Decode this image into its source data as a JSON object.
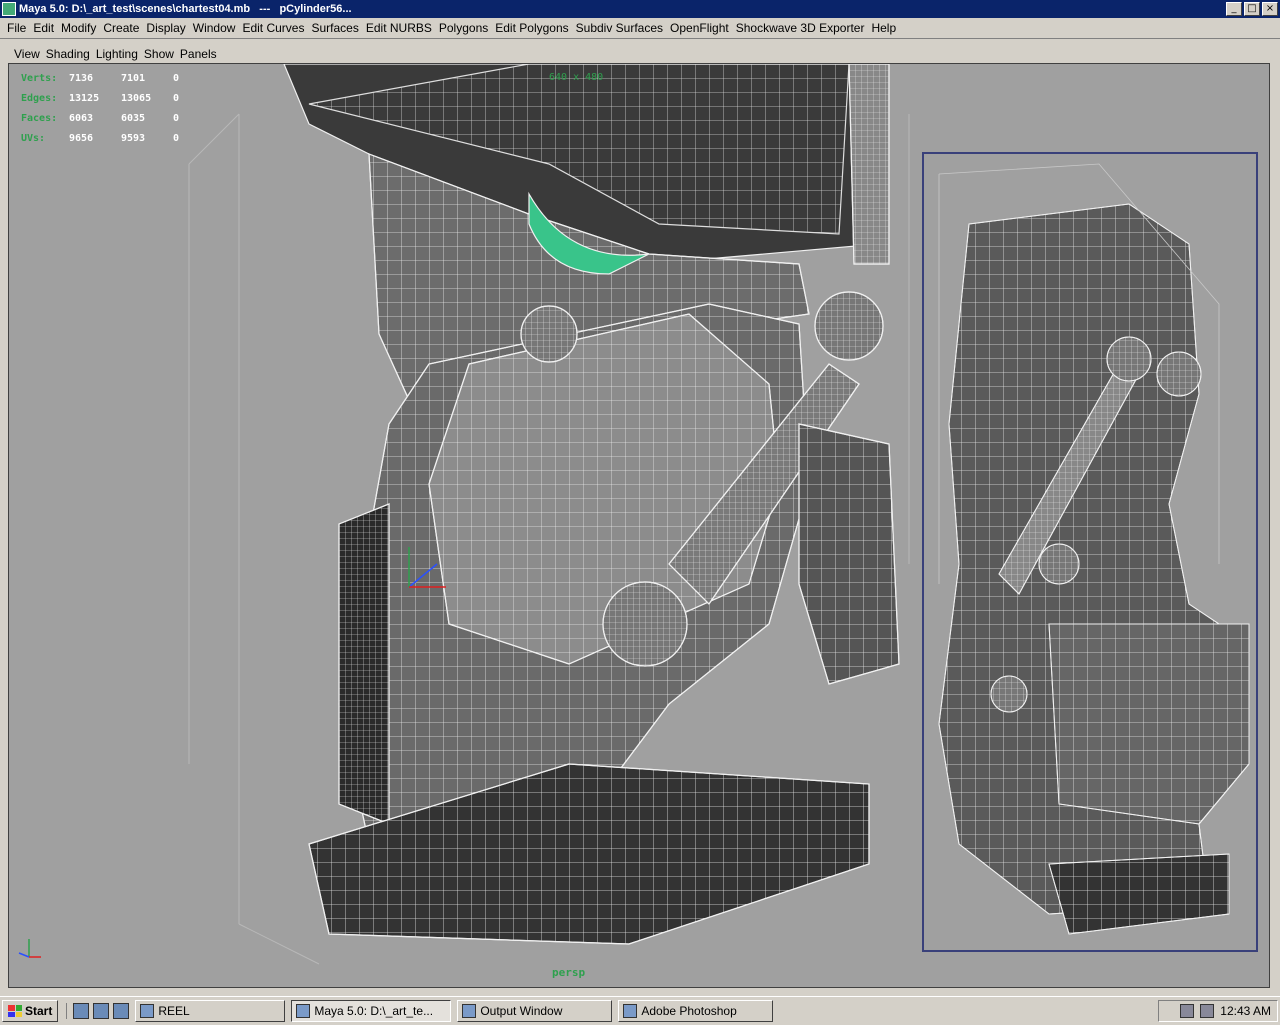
{
  "window": {
    "title": "Maya 5.0: D:\\_art_test\\scenes\\chartest04.mb   ---   pCylinder56...",
    "buttons": {
      "minimize": "_",
      "maximize": "□",
      "close": "×"
    }
  },
  "menubar": [
    "File",
    "Edit",
    "Modify",
    "Create",
    "Display",
    "Window",
    "Edit Curves",
    "Surfaces",
    "Edit NURBS",
    "Polygons",
    "Edit Polygons",
    "Subdiv Surfaces",
    "OpenFlight",
    "Shockwave 3D Exporter",
    "Help"
  ],
  "panel_menubar": [
    "View",
    "Shading",
    "Lighting",
    "Show",
    "Panels"
  ],
  "hud": [
    {
      "label": "Verts:",
      "v1": "7136",
      "v2": "7101",
      "v3": "0"
    },
    {
      "label": "Edges:",
      "v1": "13125",
      "v2": "13065",
      "v3": "0"
    },
    {
      "label": "Faces:",
      "v1": "6063",
      "v2": "6035",
      "v3": "0"
    },
    {
      "label": "UVs:",
      "v1": "9656",
      "v2": "9593",
      "v3": "0"
    }
  ],
  "viewport": {
    "resolution_gate": "640 x 480",
    "camera": "persp"
  },
  "taskbar": {
    "start": "Start",
    "tasks": [
      {
        "label": "REEL",
        "active": false
      },
      {
        "label": "Maya 5.0: D:\\_art_te...",
        "active": true
      },
      {
        "label": "Output Window",
        "active": false
      },
      {
        "label": "Adobe Photoshop",
        "active": false
      }
    ],
    "clock": "12:43 AM"
  },
  "colors": {
    "titlebar": "#0a246a",
    "viewport_bg": "#a0a0a0",
    "hud_label": "#2fa04e",
    "selection": "#39c48a"
  }
}
